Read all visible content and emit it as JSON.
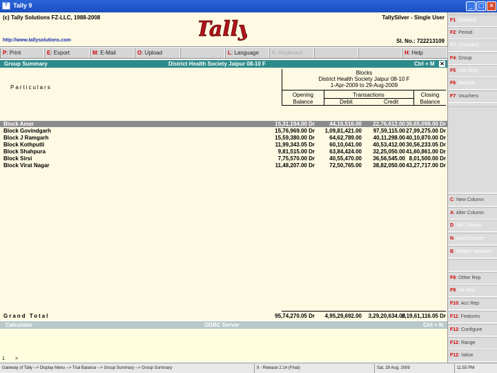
{
  "window": {
    "title": "Tally 9",
    "app_icon": "tally-app-icon",
    "controls": [
      "_",
      "□",
      "✕"
    ]
  },
  "header": {
    "copyright": "(c) Tally Solutions FZ-LLC, 1988-2008",
    "url": "http://www.tallysolutions.com",
    "logo": "Tally",
    "edition": "TallySilver - Single User",
    "serial": "Sl. No.: 722213109"
  },
  "topbar": [
    {
      "key": "P",
      "label": ": Print"
    },
    {
      "key": "E",
      "label": ": Export"
    },
    {
      "key": "M",
      "label": ": E-Mail"
    },
    {
      "key": "O",
      "label": ": Upload"
    },
    {
      "key": "L",
      "label": ": Language"
    },
    {
      "key": "K",
      "label": ": Keyboard"
    },
    {
      "key": "H",
      "label": ": Help"
    }
  ],
  "title_bar": {
    "left": "Group Summary",
    "center": "District Health Society Jaipur 08-10 F",
    "right": "Ctrl + M",
    "close": "✕"
  },
  "report": {
    "particulars_label": "Particulars",
    "col_group": "Blocks",
    "company": "District Health Society Jaipur 08-10 F",
    "period": "1-Apr-2009 to 29-Aug-2009",
    "opening": [
      "Opening",
      "Balance"
    ],
    "transactions": "Transactions",
    "debit": "Debit",
    "credit": "Credit",
    "closing": [
      "Closing",
      "Balance"
    ],
    "rows": [
      {
        "name": "Block Amer",
        "opening": "15,31,194.00 Dr",
        "debit": "44,10,516.00",
        "credit": "22,76,612.00",
        "closing": "36,65,098.00 Dr"
      },
      {
        "name": "Block Govindgarh",
        "opening": "15,76,969.00 Dr",
        "debit": "1,09,81,421.00",
        "credit": "97,59,115.00",
        "closing": "27,99,275.00 Dr"
      },
      {
        "name": "Block J Ramgarh",
        "opening": "15,59,380.00 Dr",
        "debit": "64,62,789.00",
        "credit": "40,11,298.00",
        "closing": "40,10,870.00 Dr"
      },
      {
        "name": "Block Kothputli",
        "opening": "11,99,343.05 Dr",
        "debit": "60,10,041.00",
        "credit": "40,53,412.00",
        "closing": "30,56,233.05 Dr"
      },
      {
        "name": "Block Shahpura",
        "opening": "9,81,515.00 Dr",
        "debit": "63,84,424.00",
        "credit": "32,25,050.00",
        "closing": "41,60,861.00 Dr"
      },
      {
        "name": "Block Sirsi",
        "opening": "7,75,570.00 Dr",
        "debit": "40,55,470.00",
        "credit": "36,56,545.00",
        "closing": "8,01,500.00 Dr"
      },
      {
        "name": "Block Virat Nagar",
        "opening": "11,48,207.00 Dr",
        "debit": "72,50,765.00",
        "credit": "38,82,050.00",
        "closing": "43,27,717.00 Dr"
      }
    ],
    "grand_total": {
      "label": "Grand Total",
      "opening": "95,74,270.05 Dr",
      "debit": "4,95,29,692.00",
      "credit": "3,29,20,634.00",
      "closing": "2,19,61,116.05 Dr"
    }
  },
  "calculator": {
    "left": "Calculator",
    "center": "ODBC Server",
    "right": "Ctrl + N",
    "line_num": "1",
    "prompt": ">"
  },
  "status": [
    "Gateway of Tally --> Display Menu --> Trial Balance --> Group Summary --> Group Summary",
    "9 - Release 2.14 (Final)",
    "Sat, 29 Aug, 2009",
    "11:55 PM"
  ],
  "right_panel": [
    {
      "key": "F1",
      "label": ": Detailed",
      "dim": true
    },
    {
      "key": "F2",
      "label": ": Period",
      "dim": false
    },
    {
      "key": "F3",
      "label": ": Company",
      "dim": true
    },
    {
      "key": "F4",
      "label": ": Group",
      "dim": false
    },
    {
      "key": "F5",
      "label": ": Info Only",
      "dim": true
    },
    {
      "key": "F6",
      "label": ": Monthly",
      "dim": true
    },
    {
      "key": "F7",
      "label": ": Vouchers",
      "dim": false
    },
    {
      "key": "C",
      "label": ": New Column",
      "dim": false
    },
    {
      "key": "A",
      "label": ": Alter Column",
      "dim": false
    },
    {
      "key": "D",
      "label": ": Del Column",
      "dim": true
    },
    {
      "key": "N",
      "label": ": Auto Column",
      "dim": true
    },
    {
      "key": "B",
      "label": ": Budget Variance",
      "dim": true
    },
    {
      "key": "F8",
      "label": ": Other Rep",
      "dim": false
    },
    {
      "key": "F9",
      "label": ": Inv Rep",
      "dim": true
    },
    {
      "key": "F10",
      "label": ": Acc Rep",
      "dim": false
    },
    {
      "key": "F11",
      "label": ": Features",
      "dim": false
    },
    {
      "key": "F12",
      "label": ": Configure",
      "dim": false
    },
    {
      "key": "F12",
      "label": ": Range",
      "dim": false
    },
    {
      "key": "F12",
      "label": ": Value",
      "dim": false
    }
  ]
}
